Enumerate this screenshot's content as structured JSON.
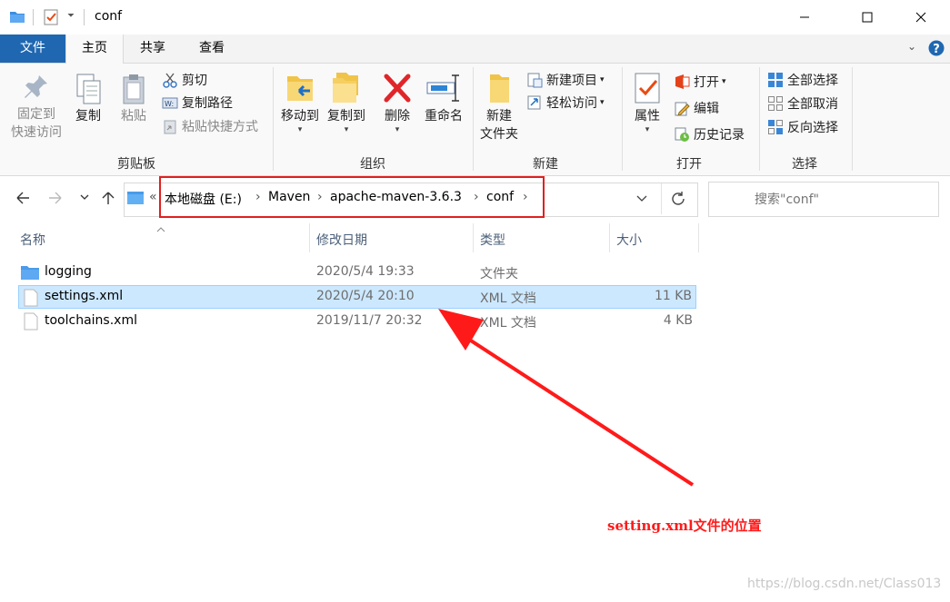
{
  "window": {
    "title": "conf"
  },
  "tabs": {
    "file": "文件",
    "home": "主页",
    "share": "共享",
    "view": "查看"
  },
  "ribbon": {
    "clipboard": {
      "pin_line1": "固定到",
      "pin_line2": "快速访问",
      "copy": "复制",
      "paste": "粘贴",
      "cut": "剪切",
      "copy_path": "复制路径",
      "paste_shortcut": "粘贴快捷方式",
      "label": "剪贴板"
    },
    "organize": {
      "move_to": "移动到",
      "copy_to": "复制到",
      "delete": "删除",
      "rename": "重命名",
      "label": "组织"
    },
    "new": {
      "new_folder_line1": "新建",
      "new_folder_line2": "文件夹",
      "new_item": "新建项目",
      "easy_access": "轻松访问",
      "label": "新建"
    },
    "open": {
      "properties": "属性",
      "open": "打开",
      "edit": "编辑",
      "history": "历史记录",
      "label": "打开"
    },
    "select": {
      "select_all": "全部选择",
      "select_none": "全部取消",
      "invert": "反向选择",
      "label": "选择"
    }
  },
  "address": {
    "overflow": "«",
    "crumbs": [
      "本地磁盘 (E:)",
      "Maven",
      "apache-maven-3.6.3",
      "conf"
    ],
    "search_placeholder": "搜索\"conf\""
  },
  "columns": {
    "name": "名称",
    "modified": "修改日期",
    "type": "类型",
    "size": "大小"
  },
  "files": [
    {
      "name": "logging",
      "modified": "2020/5/4 19:33",
      "type": "文件夹",
      "size": "",
      "kind": "folder"
    },
    {
      "name": "settings.xml",
      "modified": "2020/5/4 20:10",
      "type": "XML 文档",
      "size": "11 KB",
      "kind": "file",
      "selected": true
    },
    {
      "name": "toolchains.xml",
      "modified": "2019/11/7 20:32",
      "type": "XML 文档",
      "size": "4 KB",
      "kind": "file"
    }
  ],
  "annotation": {
    "text": "setting.xml文件的位置",
    "color": "#ff1a1a"
  },
  "watermark": "https://blog.csdn.net/Class013",
  "colors": {
    "accent": "#1f67b1",
    "selection": "#cce8ff",
    "selection_border": "#99d1ff"
  }
}
